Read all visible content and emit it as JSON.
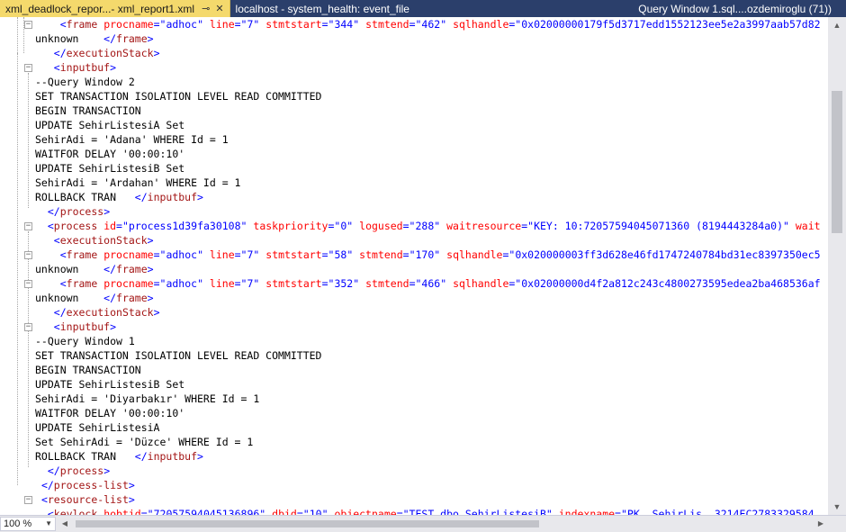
{
  "tabs": [
    {
      "label": "xml_deadlock_repor...- xml_report1.xml",
      "active": true,
      "pin_icon": "pin-icon",
      "close_icon": "close-icon"
    },
    {
      "label": "localhost - system_health: event_file",
      "active": false
    },
    {
      "label": "Query Window 1.sql....ozdemiroglu (71))",
      "active": false
    }
  ],
  "status": {
    "zoom": "100 %"
  },
  "colors": {
    "tag": "#0000ff",
    "element": "#a31515",
    "attribute": "#ff0000",
    "tab_active_bg": "#f4d96c",
    "tab_bar_bg": "#2b3f6b"
  },
  "lines": [
    [
      [
        "    ",
        "#000000"
      ],
      [
        "<",
        "#0000ff"
      ],
      [
        "frame ",
        "#a31515"
      ],
      [
        "procname",
        "#ff0000"
      ],
      [
        "=\"",
        "#0000ff"
      ],
      [
        "adhoc",
        "#0000ff"
      ],
      [
        "\" ",
        "#0000ff"
      ],
      [
        "line",
        "#ff0000"
      ],
      [
        "=\"",
        "#0000ff"
      ],
      [
        "7",
        "#0000ff"
      ],
      [
        "\" ",
        "#0000ff"
      ],
      [
        "stmtstart",
        "#ff0000"
      ],
      [
        "=\"",
        "#0000ff"
      ],
      [
        "344",
        "#0000ff"
      ],
      [
        "\" ",
        "#0000ff"
      ],
      [
        "stmtend",
        "#ff0000"
      ],
      [
        "=\"",
        "#0000ff"
      ],
      [
        "462",
        "#0000ff"
      ],
      [
        "\" ",
        "#0000ff"
      ],
      [
        "sqlhandle",
        "#ff0000"
      ],
      [
        "=\"",
        "#0000ff"
      ],
      [
        "0x02000000179f5d3717edd1552123ee5e2a3997aab57d82",
        "#0000ff"
      ]
    ],
    [
      [
        "unknown    ",
        "#000000"
      ],
      [
        "</",
        "#0000ff"
      ],
      [
        "frame",
        "#a31515"
      ],
      [
        ">",
        "#0000ff"
      ]
    ],
    [
      [
        "   ",
        "#000000"
      ],
      [
        "</",
        "#0000ff"
      ],
      [
        "executionStack",
        "#a31515"
      ],
      [
        ">",
        "#0000ff"
      ]
    ],
    [
      [
        "   ",
        "#000000"
      ],
      [
        "<",
        "#0000ff"
      ],
      [
        "inputbuf",
        "#a31515"
      ],
      [
        ">",
        "#0000ff"
      ]
    ],
    [
      [
        "--Query Window 2",
        "#000000"
      ]
    ],
    [
      [
        "SET TRANSACTION ISOLATION LEVEL READ COMMITTED",
        "#000000"
      ]
    ],
    [
      [
        "BEGIN TRANSACTION",
        "#000000"
      ]
    ],
    [
      [
        "UPDATE SehirListesiA Set",
        "#000000"
      ]
    ],
    [
      [
        "SehirAdi = 'Adana' WHERE Id = 1",
        "#000000"
      ]
    ],
    [
      [
        "WAITFOR DELAY '00:00:10'",
        "#000000"
      ]
    ],
    [
      [
        "UPDATE SehirListesiB Set",
        "#000000"
      ]
    ],
    [
      [
        "SehirAdi = 'Ardahan' WHERE Id = 1",
        "#000000"
      ]
    ],
    [
      [
        "ROLLBACK TRAN   ",
        "#000000"
      ],
      [
        "</",
        "#0000ff"
      ],
      [
        "inputbuf",
        "#a31515"
      ],
      [
        ">",
        "#0000ff"
      ]
    ],
    [
      [
        "  ",
        "#000000"
      ],
      [
        "</",
        "#0000ff"
      ],
      [
        "process",
        "#a31515"
      ],
      [
        ">",
        "#0000ff"
      ]
    ],
    [
      [
        "  ",
        "#000000"
      ],
      [
        "<",
        "#0000ff"
      ],
      [
        "process ",
        "#a31515"
      ],
      [
        "id",
        "#ff0000"
      ],
      [
        "=\"",
        "#0000ff"
      ],
      [
        "process1d39fa30108",
        "#0000ff"
      ],
      [
        "\" ",
        "#0000ff"
      ],
      [
        "taskpriority",
        "#ff0000"
      ],
      [
        "=\"",
        "#0000ff"
      ],
      [
        "0",
        "#0000ff"
      ],
      [
        "\" ",
        "#0000ff"
      ],
      [
        "logused",
        "#ff0000"
      ],
      [
        "=\"",
        "#0000ff"
      ],
      [
        "288",
        "#0000ff"
      ],
      [
        "\" ",
        "#0000ff"
      ],
      [
        "waitresource",
        "#ff0000"
      ],
      [
        "=\"",
        "#0000ff"
      ],
      [
        "KEY: 10:72057594045071360 (8194443284a0)",
        "#0000ff"
      ],
      [
        "\" ",
        "#0000ff"
      ],
      [
        "wait",
        "#ff0000"
      ]
    ],
    [
      [
        "   ",
        "#000000"
      ],
      [
        "<",
        "#0000ff"
      ],
      [
        "executionStack",
        "#a31515"
      ],
      [
        ">",
        "#0000ff"
      ]
    ],
    [
      [
        "    ",
        "#000000"
      ],
      [
        "<",
        "#0000ff"
      ],
      [
        "frame ",
        "#a31515"
      ],
      [
        "procname",
        "#ff0000"
      ],
      [
        "=\"",
        "#0000ff"
      ],
      [
        "adhoc",
        "#0000ff"
      ],
      [
        "\" ",
        "#0000ff"
      ],
      [
        "line",
        "#ff0000"
      ],
      [
        "=\"",
        "#0000ff"
      ],
      [
        "7",
        "#0000ff"
      ],
      [
        "\" ",
        "#0000ff"
      ],
      [
        "stmtstart",
        "#ff0000"
      ],
      [
        "=\"",
        "#0000ff"
      ],
      [
        "58",
        "#0000ff"
      ],
      [
        "\" ",
        "#0000ff"
      ],
      [
        "stmtend",
        "#ff0000"
      ],
      [
        "=\"",
        "#0000ff"
      ],
      [
        "170",
        "#0000ff"
      ],
      [
        "\" ",
        "#0000ff"
      ],
      [
        "sqlhandle",
        "#ff0000"
      ],
      [
        "=\"",
        "#0000ff"
      ],
      [
        "0x020000003ff3d628e46fd1747240784bd31ec8397350ec5",
        "#0000ff"
      ]
    ],
    [
      [
        "unknown    ",
        "#000000"
      ],
      [
        "</",
        "#0000ff"
      ],
      [
        "frame",
        "#a31515"
      ],
      [
        ">",
        "#0000ff"
      ]
    ],
    [
      [
        "    ",
        "#000000"
      ],
      [
        "<",
        "#0000ff"
      ],
      [
        "frame ",
        "#a31515"
      ],
      [
        "procname",
        "#ff0000"
      ],
      [
        "=\"",
        "#0000ff"
      ],
      [
        "adhoc",
        "#0000ff"
      ],
      [
        "\" ",
        "#0000ff"
      ],
      [
        "line",
        "#ff0000"
      ],
      [
        "=\"",
        "#0000ff"
      ],
      [
        "7",
        "#0000ff"
      ],
      [
        "\" ",
        "#0000ff"
      ],
      [
        "stmtstart",
        "#ff0000"
      ],
      [
        "=\"",
        "#0000ff"
      ],
      [
        "352",
        "#0000ff"
      ],
      [
        "\" ",
        "#0000ff"
      ],
      [
        "stmtend",
        "#ff0000"
      ],
      [
        "=\"",
        "#0000ff"
      ],
      [
        "466",
        "#0000ff"
      ],
      [
        "\" ",
        "#0000ff"
      ],
      [
        "sqlhandle",
        "#ff0000"
      ],
      [
        "=\"",
        "#0000ff"
      ],
      [
        "0x02000000d4f2a812c243c4800273595edea2ba468536af",
        "#0000ff"
      ]
    ],
    [
      [
        "unknown    ",
        "#000000"
      ],
      [
        "</",
        "#0000ff"
      ],
      [
        "frame",
        "#a31515"
      ],
      [
        ">",
        "#0000ff"
      ]
    ],
    [
      [
        "   ",
        "#000000"
      ],
      [
        "</",
        "#0000ff"
      ],
      [
        "executionStack",
        "#a31515"
      ],
      [
        ">",
        "#0000ff"
      ]
    ],
    [
      [
        "   ",
        "#000000"
      ],
      [
        "<",
        "#0000ff"
      ],
      [
        "inputbuf",
        "#a31515"
      ],
      [
        ">",
        "#0000ff"
      ]
    ],
    [
      [
        "--Query Window 1",
        "#000000"
      ]
    ],
    [
      [
        "SET TRANSACTION ISOLATION LEVEL READ COMMITTED",
        "#000000"
      ]
    ],
    [
      [
        "BEGIN TRANSACTION",
        "#000000"
      ]
    ],
    [
      [
        "UPDATE SehirListesiB Set",
        "#000000"
      ]
    ],
    [
      [
        "SehirAdi = 'Diyarbakır' WHERE Id = 1",
        "#000000"
      ]
    ],
    [
      [
        "WAITFOR DELAY '00:00:10'",
        "#000000"
      ]
    ],
    [
      [
        "UPDATE SehirListesiA",
        "#000000"
      ]
    ],
    [
      [
        "Set SehirAdi = 'Düzce' WHERE Id = 1",
        "#000000"
      ]
    ],
    [
      [
        "ROLLBACK TRAN   ",
        "#000000"
      ],
      [
        "</",
        "#0000ff"
      ],
      [
        "inputbuf",
        "#a31515"
      ],
      [
        ">",
        "#0000ff"
      ]
    ],
    [
      [
        "  ",
        "#000000"
      ],
      [
        "</",
        "#0000ff"
      ],
      [
        "process",
        "#a31515"
      ],
      [
        ">",
        "#0000ff"
      ]
    ],
    [
      [
        " ",
        "#000000"
      ],
      [
        "</",
        "#0000ff"
      ],
      [
        "process-list",
        "#a31515"
      ],
      [
        ">",
        "#0000ff"
      ]
    ],
    [
      [
        " ",
        "#000000"
      ],
      [
        "<",
        "#0000ff"
      ],
      [
        "resource-list",
        "#a31515"
      ],
      [
        ">",
        "#0000ff"
      ]
    ],
    [
      [
        "  ",
        "#000000"
      ],
      [
        "<",
        "#0000ff"
      ],
      [
        "keylock ",
        "#a31515"
      ],
      [
        "hobtid",
        "#ff0000"
      ],
      [
        "=\"",
        "#0000ff"
      ],
      [
        "72057594045136896",
        "#0000ff"
      ],
      [
        "\" ",
        "#0000ff"
      ],
      [
        "dbid",
        "#ff0000"
      ],
      [
        "=\"",
        "#0000ff"
      ],
      [
        "10",
        "#0000ff"
      ],
      [
        "\" ",
        "#0000ff"
      ],
      [
        "objectname",
        "#ff0000"
      ],
      [
        "=\"",
        "#0000ff"
      ],
      [
        "TEST.dbo.SehirListesiB",
        "#0000ff"
      ],
      [
        "\" ",
        "#0000ff"
      ],
      [
        "indexname",
        "#ff0000"
      ],
      [
        "=\"",
        "#0000ff"
      ],
      [
        "PK__SehirLis__3214EC2783329584",
        "#0000ff"
      ]
    ]
  ]
}
